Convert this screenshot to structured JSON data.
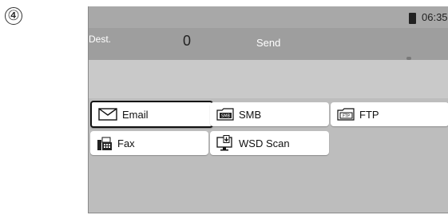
{
  "step_number": "④",
  "status_bar": {
    "time": "06:35"
  },
  "destination_bar": {
    "dest_label": "Dest.",
    "dest_count": "0",
    "send_label": "Send"
  },
  "buttons": [
    {
      "label": "Email",
      "icon": "envelope-icon",
      "selected": true
    },
    {
      "label": "SMB",
      "icon": "smb-folder-icon",
      "selected": false
    },
    {
      "label": "FTP",
      "icon": "ftp-folder-icon",
      "selected": false
    },
    {
      "label": "Fax",
      "icon": "fax-icon",
      "selected": false
    },
    {
      "label": "WSD Scan",
      "icon": "wsd-scan-icon",
      "selected": false
    }
  ],
  "colors": {
    "selected_border": "#111111",
    "panel_background": "#bdbdbd",
    "button_background": "#ffffff"
  }
}
